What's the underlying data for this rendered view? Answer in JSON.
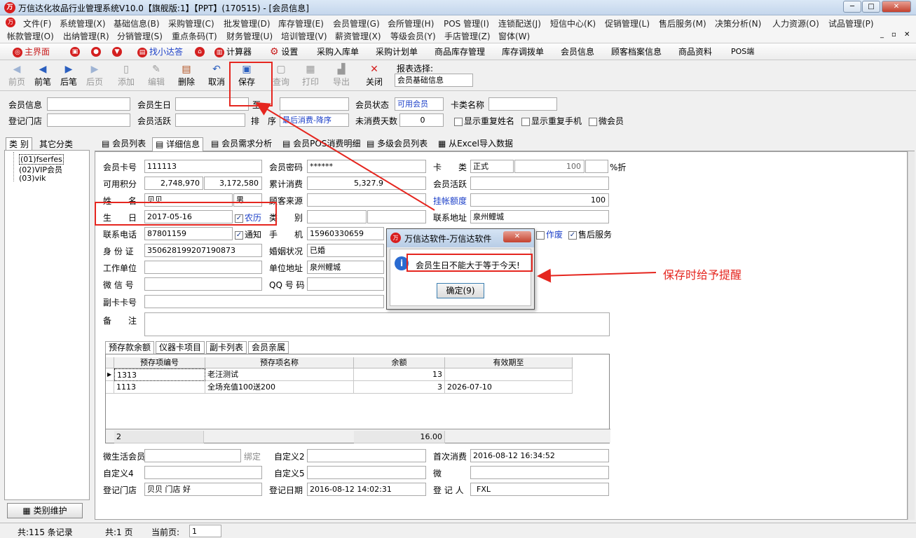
{
  "window": {
    "title": "万信达化妆品行业管理系统V10.0【旗舰版:1】【PPT】(170515) - [会员信息]",
    "logo": "logo-icon"
  },
  "menu": {
    "row1": [
      "文件(F)",
      "系统管理(X)",
      "基础信息(B)",
      "采购管理(C)",
      "批发管理(D)",
      "库存管理(E)",
      "会员管理(G)",
      "会所管理(H)",
      "POS 管理(I)",
      "连锁配送(J)",
      "短信中心(K)",
      "促销管理(L)",
      "售后服务(M)",
      "决策分析(N)",
      "人力资源(O)",
      "试品管理(P)"
    ],
    "row2": [
      "帐款管理(O)",
      "出纳管理(R)",
      "分销管理(S)",
      "重点条码(T)",
      "财务管理(U)",
      "培训管理(V)",
      "薪资管理(X)",
      "等级会员(Y)",
      "手店管理(Z)",
      "窗体(W)"
    ]
  },
  "quick": [
    "主界面",
    "找小达答",
    "计算器",
    "设置",
    "采购入库单",
    "采购计划单",
    "商品库存管理",
    "库存调拨单",
    "会员信息",
    "顾客档案信息",
    "商品资料",
    "POS端"
  ],
  "toolbar": {
    "buttons": [
      "前页",
      "前笔",
      "后笔",
      "后页",
      "添加",
      "编辑",
      "删除",
      "取消",
      "保存",
      "查询",
      "打印",
      "导出",
      "关闭"
    ],
    "report_label": "报表选择:",
    "report_value": "会员基础信息"
  },
  "filter": {
    "member_info": "会员信息",
    "birthday": "会员生日",
    "to": "至",
    "status_label": "会员状态",
    "status_value": "可用会员",
    "card_type": "卡类名称",
    "store": "登记门店",
    "active": "会员活跃",
    "sort_label": "排　序",
    "sort_value": "最后消费-降序",
    "days_label": "未消费天数",
    "days_value": "0",
    "dup_name": "显示重复姓名",
    "dup_phone": "显示重复手机",
    "wechat": "微会员"
  },
  "left": {
    "tabs": [
      "类 别",
      "其它分类"
    ],
    "tree": [
      "(01)fserfes",
      "(02)VIP会员",
      "(03)vik"
    ],
    "maintain": "类别维护"
  },
  "tabs": [
    "会员列表",
    "详细信息",
    "会员需求分析",
    "会员POS消费明细",
    "多级会员列表",
    "从Excel导入数据"
  ],
  "form": {
    "card_no_l": "会员卡号",
    "card_no": "111113",
    "pwd_l": "会员密码",
    "pwd": "******",
    "card_type_l": "卡　　类",
    "card_type": "正式",
    "discount": "100",
    "discount_unit": "%折",
    "points_l": "可用积分",
    "points1": "2,748,970",
    "points2": "3,172,580",
    "total_l": "累计消费",
    "total": "5,327.9",
    "active_l": "会员活跃",
    "name_l": "姓　　名",
    "name": "贝贝",
    "sex": "男",
    "source_l": "顾客来源",
    "credit_l": "挂帐额度",
    "credit": "100",
    "birth_l": "生　　日",
    "birth": "2017-05-16",
    "lunar": "农历",
    "type_l": "类　　别",
    "addr_l": "联系地址",
    "addr": "泉州鲤城",
    "phone_l": "联系电话",
    "phone": "87801159",
    "notify": "通知",
    "mobile_l": "手　　机",
    "mobile": "15960330659",
    "void": "作废",
    "after": "售后服务",
    "id_l": "身 份 证",
    "id": "350628199207190873",
    "marriage_l": "婚姻状况",
    "marriage": "已婚",
    "work_l": "工作单位",
    "unit_addr_l": "单位地址",
    "unit_addr": "泉州鲤城",
    "wx_l": "微 信 号",
    "qq_l": "QQ 号 码",
    "sub_l": "副卡卡号",
    "remark_l": "备　　注",
    "wxlife_l": "微生活会员",
    "bind": "绑定",
    "c2_l": "自定义2",
    "first_l": "首次消费",
    "first": "2016-08-12 16:34:52",
    "c4_l": "自定义4",
    "c5_l": "自定义5",
    "wei_l": "微",
    "reg_store_l": "登记门店",
    "reg_store": "贝贝 门店 好",
    "reg_date_l": "登记日期",
    "reg_date": "2016-08-12 14:02:31",
    "reg_by_l": "登 记 人",
    "reg_by": "FXL"
  },
  "subtabs": [
    "预存款余额",
    "仪器卡项目",
    "副卡列表",
    "会员亲属"
  ],
  "grid": {
    "headers": [
      "预存项编号",
      "预存项名称",
      "余额",
      "有效期至"
    ],
    "rows": [
      [
        "1313",
        "老汪测试",
        "13",
        ""
      ],
      [
        "1113",
        "全场充值100送200",
        "3",
        "2026-07-10"
      ]
    ],
    "footer_count": "2",
    "footer_sum": "16.00"
  },
  "status": {
    "records": "共:115 条记录",
    "pages": "共:1 页",
    "current_l": "当前页:",
    "current": "1"
  },
  "dialog": {
    "title": "万信达软件-万信达软件",
    "message": "会员生日不能大于等于今天!",
    "ok": "确定(9)"
  },
  "annotation": "保存时给予提醒",
  "colors": {
    "accent": "#e5261f",
    "link": "#1b3fc8"
  }
}
